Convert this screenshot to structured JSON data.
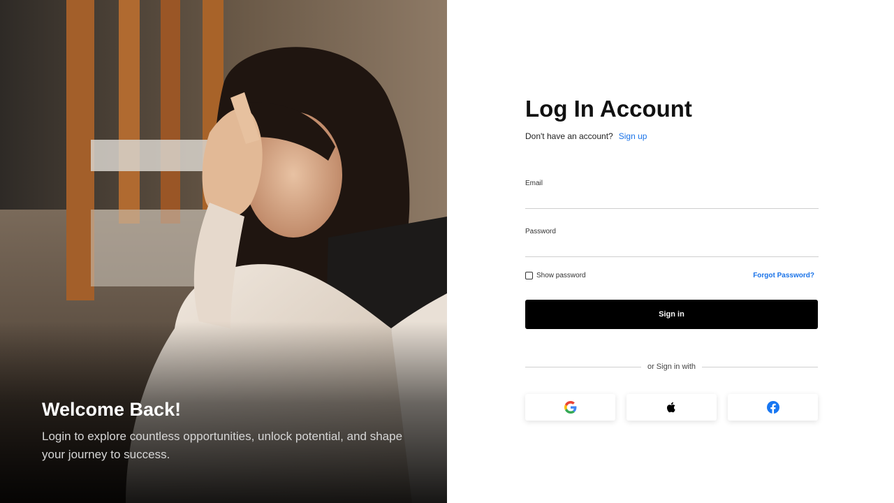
{
  "hero": {
    "title": "Welcome Back!",
    "subtitle": "Login to explore countless opportunities, unlock potential, and shape your journey to success."
  },
  "form": {
    "title": "Log In Account",
    "signup_prompt": "Don't have an account?",
    "signup_link": "Sign up",
    "email_label": "Email",
    "email_value": "",
    "password_label": "Password",
    "password_value": "",
    "show_password_label": "Show password",
    "show_password_checked": false,
    "forgot_password_link": "Forgot Password?",
    "signin_button": "Sign in",
    "divider_text": "or Sign in with"
  },
  "social": [
    {
      "icon": "google-icon",
      "color": "#4285F4"
    },
    {
      "icon": "apple-icon",
      "color": "#000000"
    },
    {
      "icon": "facebook-icon",
      "color": "#1877F2"
    }
  ],
  "colors": {
    "accent": "#1a73e8",
    "primary_button": "#000000",
    "background": "#ffffff"
  }
}
